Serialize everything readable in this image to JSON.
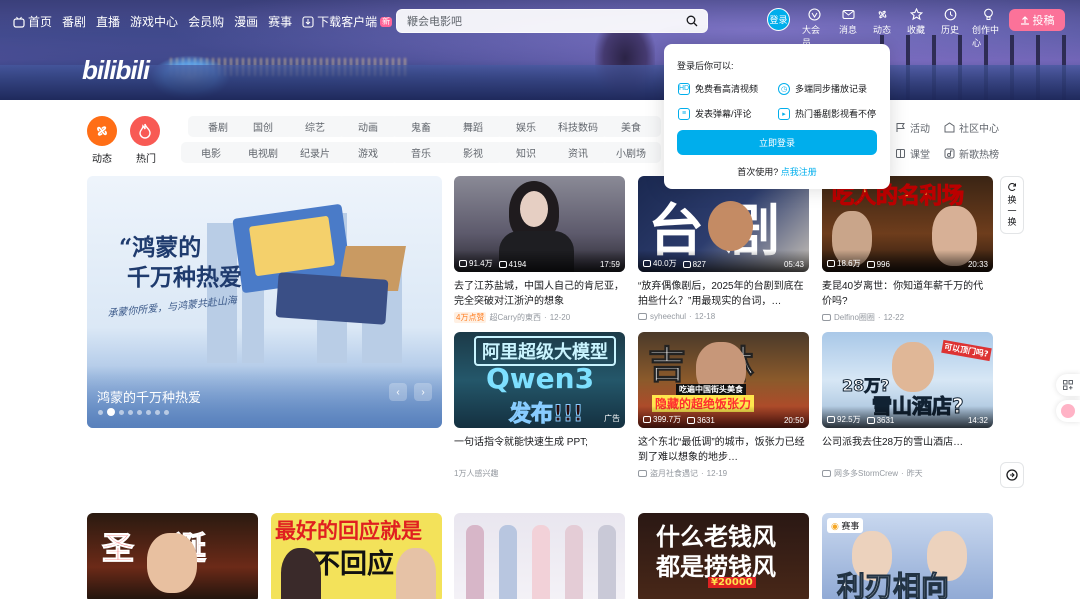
{
  "nav": {
    "left": [
      {
        "icon": "bilibili-tv-icon",
        "label": "首页"
      },
      {
        "label": "番剧"
      },
      {
        "label": "直播"
      },
      {
        "label": "游戏中心"
      },
      {
        "label": "会员购"
      },
      {
        "label": "漫画"
      },
      {
        "label": "赛事"
      },
      {
        "icon": "download-icon",
        "label": "下载客户端",
        "badge": "新"
      }
    ],
    "search_placeholder": "鞭会电影吧",
    "login": "登录",
    "right": [
      "大会员",
      "消息",
      "动态",
      "收藏",
      "历史",
      "创作中心"
    ],
    "upload": "投稿",
    "logo": "bilibili"
  },
  "channels": {
    "dynamic": "动态",
    "hot": "热门",
    "row1": [
      "番剧",
      "国创",
      "综艺",
      "动画",
      "鬼畜",
      "舞蹈",
      "娱乐",
      "科技数码",
      "美食"
    ],
    "row2": [
      "电影",
      "电视剧",
      "纪录片",
      "游戏",
      "音乐",
      "影视",
      "知识",
      "资讯",
      "小剧场"
    ],
    "right1": [
      "活动",
      "社区中心"
    ],
    "right2": [
      "课堂",
      "新歌热榜"
    ]
  },
  "popup": {
    "title": "登录后你可以:",
    "features": [
      "免费看高清视频",
      "多端同步播放记录",
      "发表弹幕/评论",
      "热门番剧影视看不停"
    ],
    "login_button": "立即登录",
    "first_use": "首次使用?",
    "register": "点我注册"
  },
  "carousel": {
    "headline1": "“鸿蒙的",
    "headline2": "千万种热爱",
    "script": "承蒙你所爱，与鸿蒙共赴山海",
    "caption": "鸿蒙的千万种热爱",
    "dots": 8,
    "active_dot": 1
  },
  "videos": [
    {
      "views": "91.4万",
      "danmaku": "4194",
      "duration": "17:59",
      "title": "去了江苏盐城，中国人自己的肯尼亚，完全突破对江浙沪的想象",
      "hot": "4万点赞",
      "author": "超Carry的東西",
      "date": "12-20"
    },
    {
      "views": "40.0万",
      "danmaku": "827",
      "duration": "05:43",
      "title": "“放弃偶像剧后，2025年的台剧到底在拍些什么？”用最现实的台词，…",
      "author": "syheechul",
      "date": "12-18",
      "overlay": "台剧"
    },
    {
      "views": "18.6万",
      "danmaku": "996",
      "duration": "20:33",
      "title": "麦昆40岁离世：你知道年薪千万的代价吗?",
      "author": "Delfino圈圈",
      "date": "12-22",
      "overlay": "吃人的名利场"
    },
    {
      "title": "一句话指令就能快速生成 PPT;",
      "author": "1万人感兴趣",
      "ad": "广告",
      "overlay1": "阿里超级大模型",
      "overlay2": "Qwen3",
      "overlay3": "发布!!!"
    },
    {
      "views": "399.7万",
      "danmaku": "3631",
      "duration": "20:50",
      "title": "这个东北“最低调”的城市，饭张力已经到了难以想象的地步…",
      "author": "盗月社食遇记",
      "date": "12-19",
      "overlay1": "吉林",
      "overlay2": "吃遍中国街头美食",
      "overlay3": "隐藏的超绝饭张力"
    },
    {
      "views": "92.5万",
      "danmaku": "3631",
      "duration": "14:32",
      "title": "公司派我去住28万的雪山酒店…",
      "author": "网多多StormCrew",
      "date": "昨天",
      "overlay1": "28万?",
      "overlay2": "雪山酒店?",
      "overlay3": "可以顶门吗?"
    }
  ],
  "bottom": [
    {
      "overlay": "圣诞"
    },
    {
      "overlay1": "最好的回应就是",
      "overlay2": "不回应"
    },
    {
      "overlay": ""
    },
    {
      "overlay1": "什么老钱风",
      "overlay2": "都是捞钱风",
      "overlay3": "¥20000"
    },
    {
      "badge": "赛事",
      "overlay": "利刃相向"
    }
  ],
  "side": {
    "refresh": "换一换"
  },
  "colors": {
    "accent": "#00aeec",
    "pink": "#fb7299",
    "orange": "#ff7f24"
  }
}
